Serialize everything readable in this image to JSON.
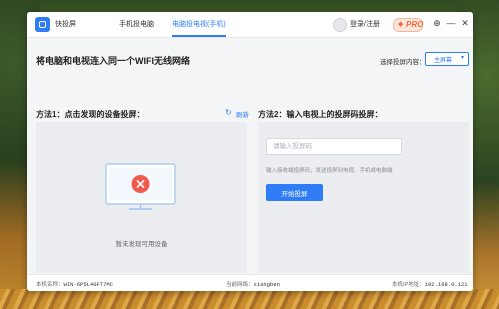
{
  "app": {
    "name": "快投屏"
  },
  "tabs": [
    {
      "label": "手机投电脑"
    },
    {
      "label": "电脑投电视(手机)"
    }
  ],
  "header": {
    "login": "登录/注册",
    "pro_badge": "PRO"
  },
  "page": {
    "title": "将电脑和电视连入同一个WIFI无线网络"
  },
  "select": {
    "label": "选择投屏内容：",
    "value": "主屏幕"
  },
  "method1": {
    "title": "方法1：点击发现的设备投屏：",
    "refresh_label": "刷新",
    "empty_text": "暂未发现可用设备"
  },
  "method2": {
    "title": "方法2：输入电视上的投屏码投屏：",
    "input_placeholder": "请输入投屏码",
    "input_value": "",
    "hint": "输入接收端投屏码，发送投屏到电视、手机或电脑端",
    "button": "开始投屏"
  },
  "status": {
    "device_label": "本机名称：",
    "device_value": "WIN-6P5L40FT7MC",
    "network_label": "当前网络：",
    "network_value": "xiangben",
    "ip_label": "本机IP地址：",
    "ip_value": "192.168.0.121"
  },
  "colors": {
    "accent": "#2f7df6",
    "pro": "#f06c3c",
    "error": "#f05a4e"
  },
  "icons": [
    "app-logo-icon",
    "avatar-icon",
    "diamond-icon",
    "target-icon",
    "minimize-icon",
    "close-icon",
    "refresh-icon",
    "monitor-icon",
    "error-x-icon"
  ]
}
